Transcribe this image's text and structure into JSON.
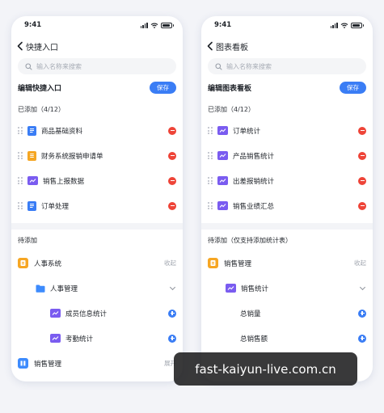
{
  "colors": {
    "accent": "#3a7df5",
    "remove": "#ee4438",
    "doc_blue": "#3a7df5",
    "doc_yellow": "#f5a623",
    "chart_purple": "#7a5cf0",
    "folder_blue": "#3d8bfd",
    "system_orange": "#f6a623"
  },
  "left": {
    "status_time": "9:41",
    "nav_title": "快捷入口",
    "search_placeholder": "输入名称来搜索",
    "edit_title": "编辑快捷入口",
    "save_label": "保存",
    "added_label": "已添加（4/12）",
    "added_items": [
      {
        "label": "商品基础资料",
        "icon": "document-icon"
      },
      {
        "label": "财务系统报销申请单",
        "icon": "receipt-icon"
      },
      {
        "label": "销售上报数据",
        "icon": "chart-icon"
      },
      {
        "label": "订单处理",
        "icon": "document-icon"
      }
    ],
    "pending_label": "待添加",
    "tree": {
      "system": "人事系统",
      "system_action": "收起",
      "module": "人事管理",
      "items": [
        "成员信息统计",
        "考勤统计"
      ],
      "next_system": "销售管理",
      "next_system_action": "展开"
    }
  },
  "right": {
    "status_time": "9:41",
    "nav_title": "图表看板",
    "search_placeholder": "输入名称来搜索",
    "edit_title": "编辑图表看板",
    "save_label": "保存",
    "added_label": "已添加（4/12）",
    "added_items": [
      {
        "label": "订单统计",
        "icon": "chart-icon"
      },
      {
        "label": "产品销售统计",
        "icon": "chart-icon"
      },
      {
        "label": "出差报销统计",
        "icon": "chart-icon"
      },
      {
        "label": "销售业绩汇总",
        "icon": "chart-icon"
      }
    ],
    "pending_label": "待添加（仅支持添加统计表）",
    "tree": {
      "system": "销售管理",
      "system_action": "收起",
      "module": "销售统计",
      "items": [
        "总销量",
        "总销售额"
      ]
    }
  },
  "watermark": "fast-kaiyun-live.com.cn"
}
